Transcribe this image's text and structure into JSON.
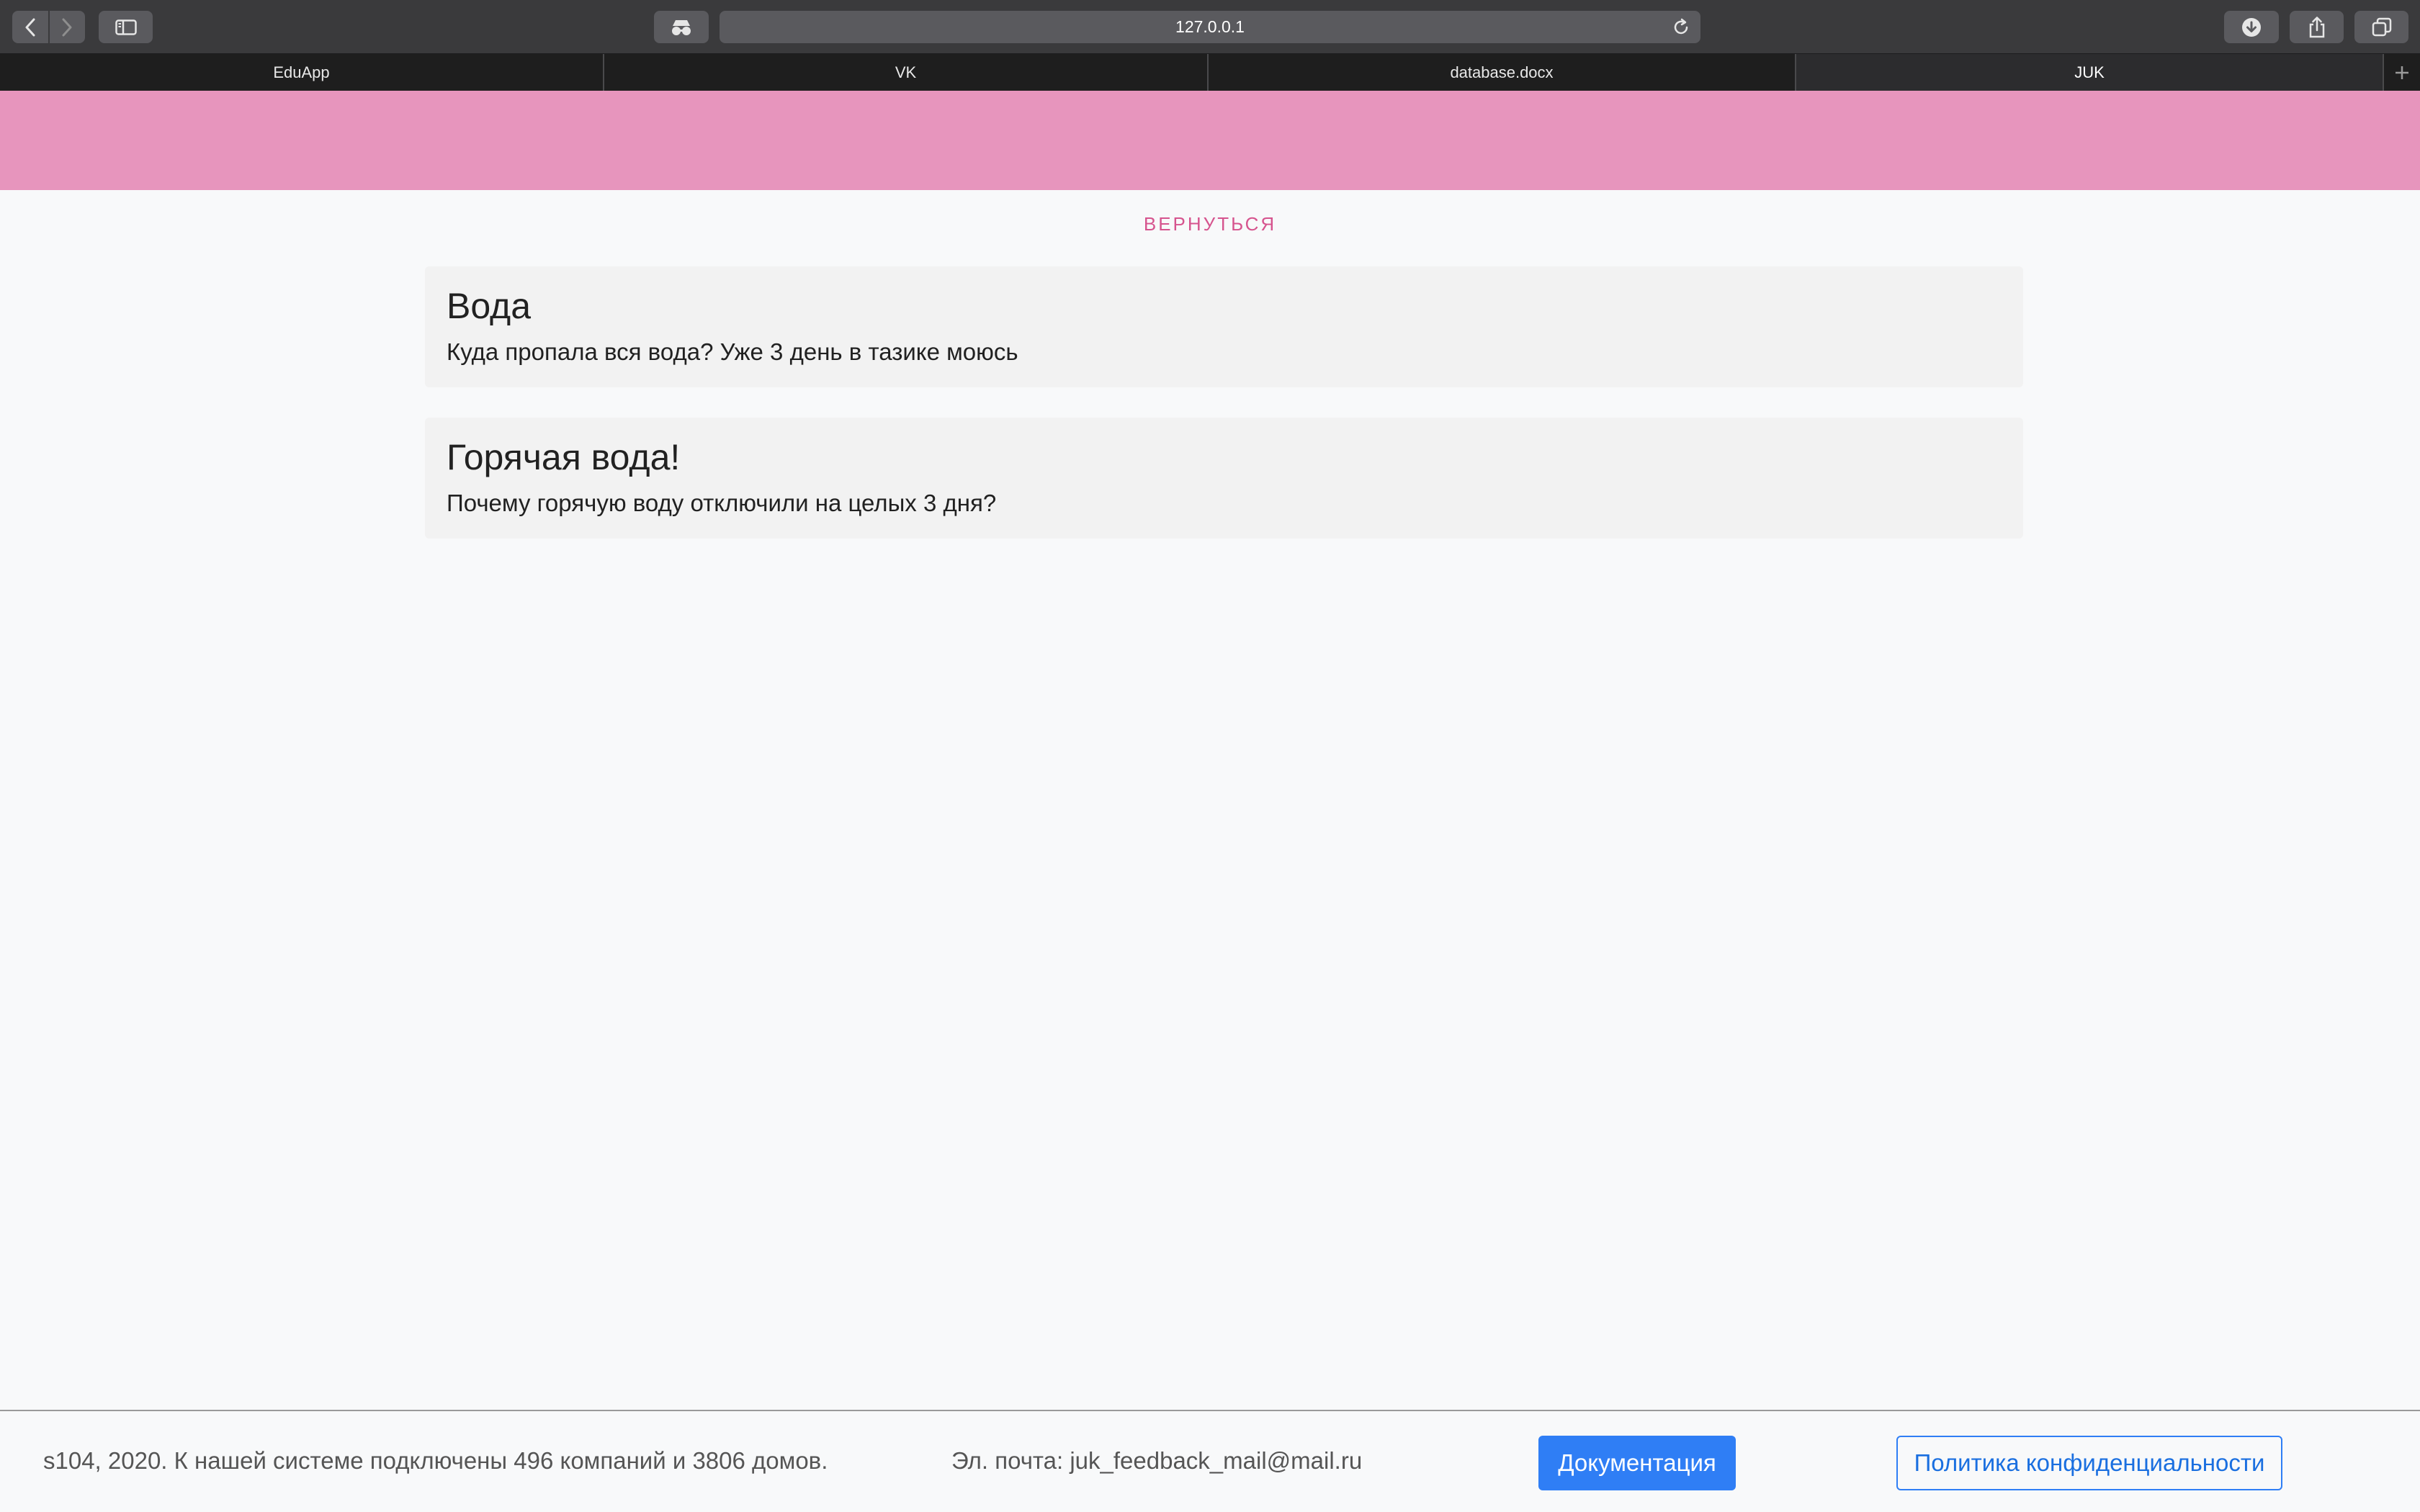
{
  "browser": {
    "url": "127.0.0.1",
    "tabs": [
      {
        "label": "EduApp",
        "active": false
      },
      {
        "label": "VK",
        "active": false
      },
      {
        "label": "database.docx",
        "active": false
      },
      {
        "label": "JUK",
        "active": true
      }
    ]
  },
  "page": {
    "back_label": "ВЕРНУТЬСЯ",
    "accent_color": "#e795bd",
    "cards": [
      {
        "title": "Вода",
        "text": "Куда пропала вся вода? Уже 3 день в тазике моюсь"
      },
      {
        "title": "Горячая вода!",
        "text": "Почему горячую воду отключили на целых 3 дня?"
      }
    ]
  },
  "footer": {
    "copyright": "s104, 2020. К нашей системе подключены 496 компаний и 3806 домов.",
    "email": "Эл. почта: juk_feedback_mail@mail.ru",
    "docs_button": "Документация",
    "policy_button": "Политика конфиденциальности"
  }
}
